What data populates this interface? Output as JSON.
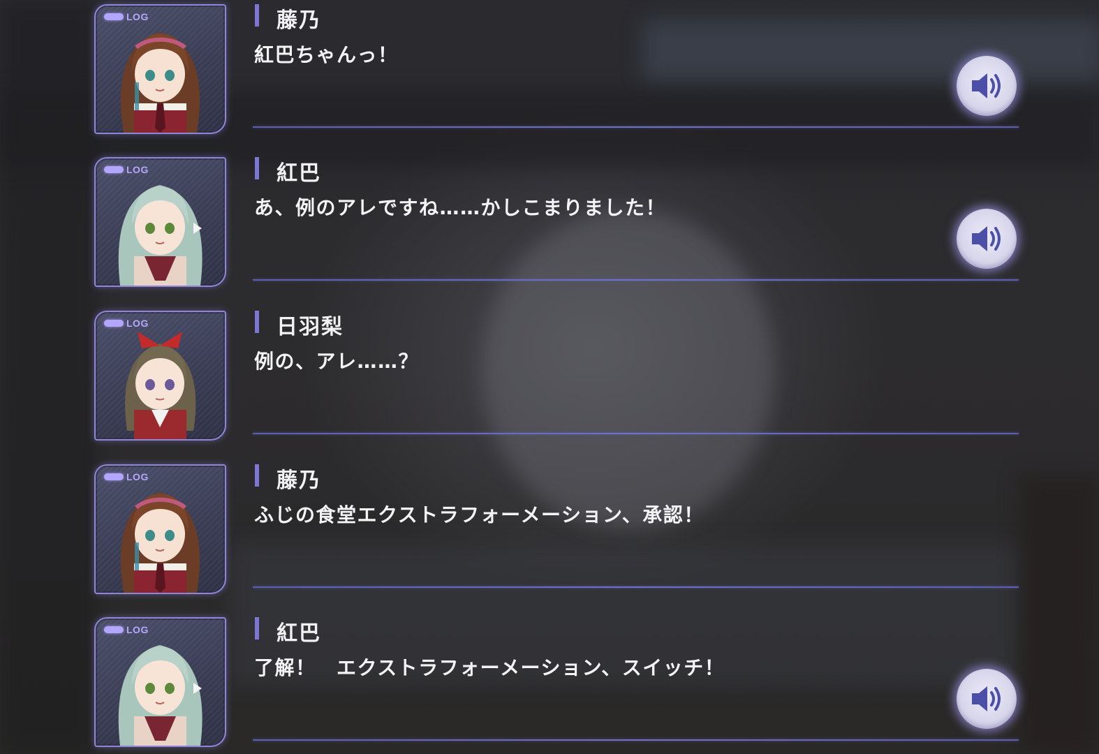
{
  "log_badge_text": "LOG",
  "colors": {
    "accent": "#7d76d6",
    "divider": "#6f73c8",
    "text": "#f4f4f6",
    "voice_icon": "#4b4fa8"
  },
  "entries": [
    {
      "speaker": "藤乃",
      "text": "紅巴ちゃんっ！",
      "character": "fujino",
      "has_voice": true
    },
    {
      "speaker": "紅巴",
      "text": "あ、例のアレですね……かしこまりました！",
      "character": "tomoe",
      "has_voice": true
    },
    {
      "speaker": "日羽梨",
      "text": "例の、アレ……？",
      "character": "hiyori",
      "has_voice": false
    },
    {
      "speaker": "藤乃",
      "text": "ふじの食堂エクストラフォーメーション、承認！",
      "character": "fujino",
      "has_voice": false
    },
    {
      "speaker": "紅巴",
      "text": "了解！　エクストラフォーメーション、スイッチ！",
      "character": "tomoe",
      "has_voice": true
    }
  ],
  "icons": {
    "voice": "speaker-volume-icon",
    "log": "log-badge"
  }
}
